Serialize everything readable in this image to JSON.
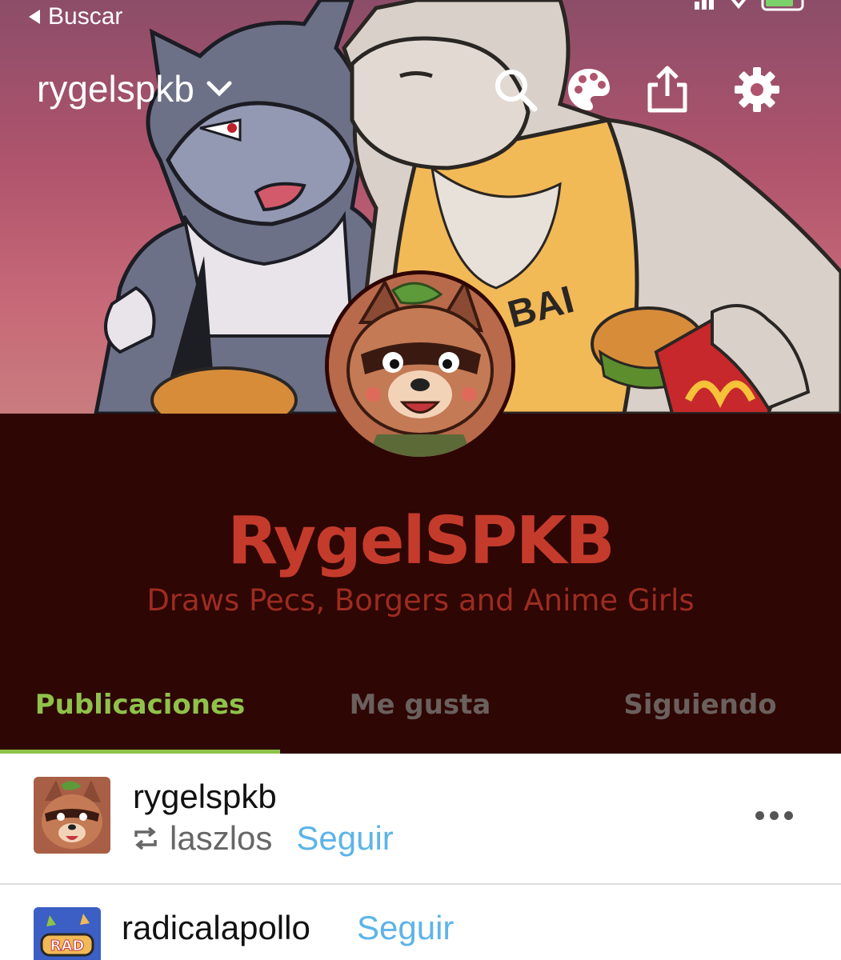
{
  "status_bar": {
    "back_label": "Buscar"
  },
  "header": {
    "blog_name": "rygelspkb",
    "icons": [
      "search-icon",
      "palette-icon",
      "share-icon",
      "settings-icon"
    ]
  },
  "profile": {
    "title": "RygelSPKB",
    "description": "Draws Pecs, Borgers and Anime Girls",
    "title_color": "#c43b2c",
    "background_color": "#2e0604"
  },
  "tabs": [
    {
      "label": "Publicaciones",
      "active": true
    },
    {
      "label": "Me gusta",
      "active": false
    },
    {
      "label": "Siguiendo",
      "active": false
    }
  ],
  "accent_color": "#8fc24a",
  "feed": {
    "posts": [
      {
        "author": "rygelspkb",
        "reblogged_from": "laszlos",
        "follow_label": "Seguir"
      },
      {
        "author": "radicalapollo",
        "follow_label": "Seguir",
        "avatar_text": "RAD"
      }
    ]
  }
}
